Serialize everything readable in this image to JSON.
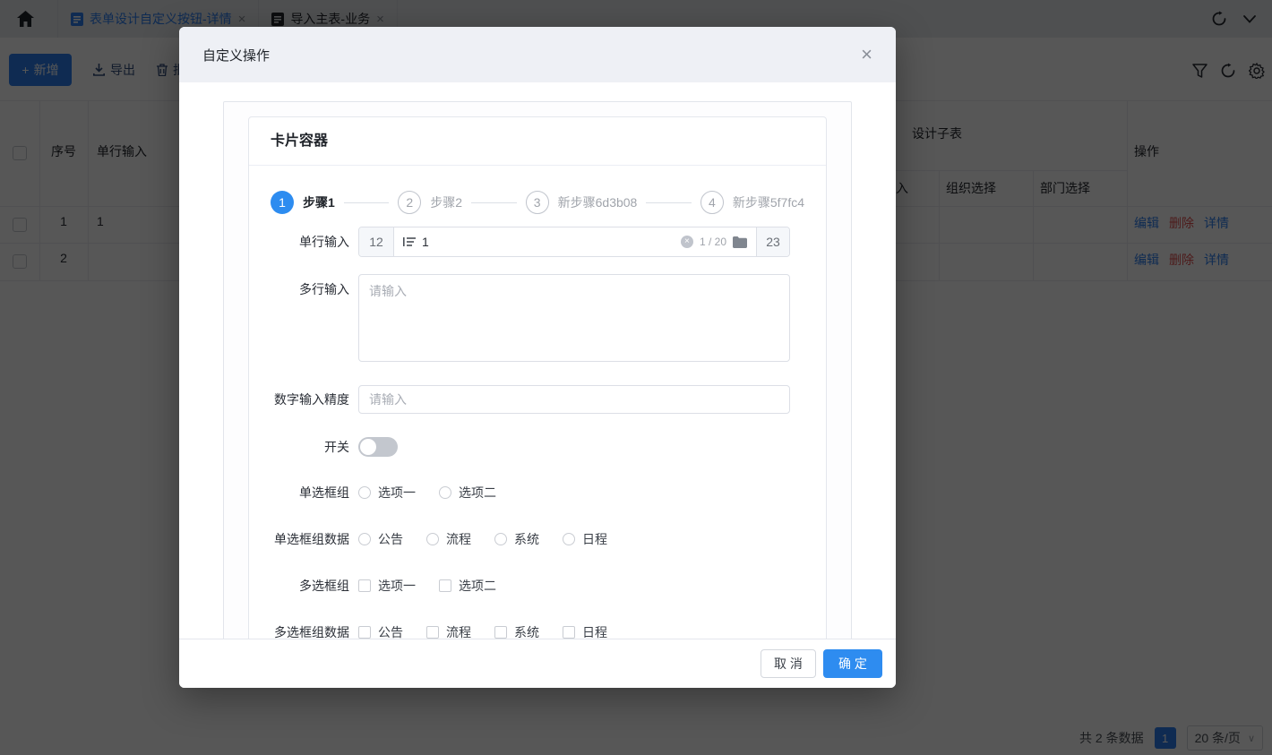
{
  "topbar": {
    "tabs": [
      {
        "label": "表单设计自定义按钮-详情",
        "active": true
      },
      {
        "label": "导入主表-业务",
        "active": false
      }
    ],
    "close_glyph": "×"
  },
  "toolbar": {
    "add_plus": "+",
    "add_label": "新增",
    "export_label": "导出",
    "batch_delete_label": "批量删除"
  },
  "table": {
    "group_header": "设计子表",
    "partial_column_fragment": "入",
    "columns": {
      "seq": "序号",
      "single_input": "单行输入",
      "org_select": "组织选择",
      "dept_select": "部门选择",
      "actions": "操作"
    },
    "actions": {
      "edit": "编辑",
      "delete": "删除",
      "detail": "详情"
    },
    "rows": [
      {
        "seq": "1",
        "single_input": "1"
      },
      {
        "seq": "2",
        "single_input": ""
      }
    ]
  },
  "pagination": {
    "total": "共 2 条数据",
    "current_page": "1",
    "page_size": "20 条/页",
    "chevron": "∨"
  },
  "modal": {
    "title": "自定义操作",
    "close_glyph": "×",
    "card_title": "卡片容器",
    "steps": [
      {
        "num": "1",
        "label": "步骤1",
        "active": true
      },
      {
        "num": "2",
        "label": "步骤2",
        "active": false
      },
      {
        "num": "3",
        "label": "新步骤6d3b08",
        "active": false
      },
      {
        "num": "4",
        "label": "新步骤5f7fc4",
        "active": false
      }
    ],
    "form": {
      "single_line": {
        "label": "单行输入",
        "prepend": "12",
        "value": "1",
        "clear_glyph": "×",
        "counter": "1 / 20",
        "append": "23"
      },
      "multi_line": {
        "label": "多行输入",
        "placeholder": "请输入"
      },
      "number_precision": {
        "label": "数字输入精度",
        "placeholder": "请输入"
      },
      "switch": {
        "label": "开关",
        "on": false
      },
      "radio_group": {
        "label": "单选框组",
        "options": [
          "选项一",
          "选项二"
        ]
      },
      "radio_group_data": {
        "label": "单选框组数据",
        "options": [
          "公告",
          "流程",
          "系统",
          "日程"
        ]
      },
      "checkbox_group": {
        "label": "多选框组",
        "options": [
          "选项一",
          "选项二"
        ]
      },
      "checkbox_group_data": {
        "label": "多选框组数据",
        "options": [
          "公告",
          "流程",
          "系统",
          "日程"
        ]
      }
    },
    "footer": {
      "cancel": "取 消",
      "confirm": "确 定"
    }
  },
  "colors": {
    "accent": "#2d7ff0",
    "danger": "#e25050",
    "overlay": "rgba(0,0,0,0.66)"
  }
}
